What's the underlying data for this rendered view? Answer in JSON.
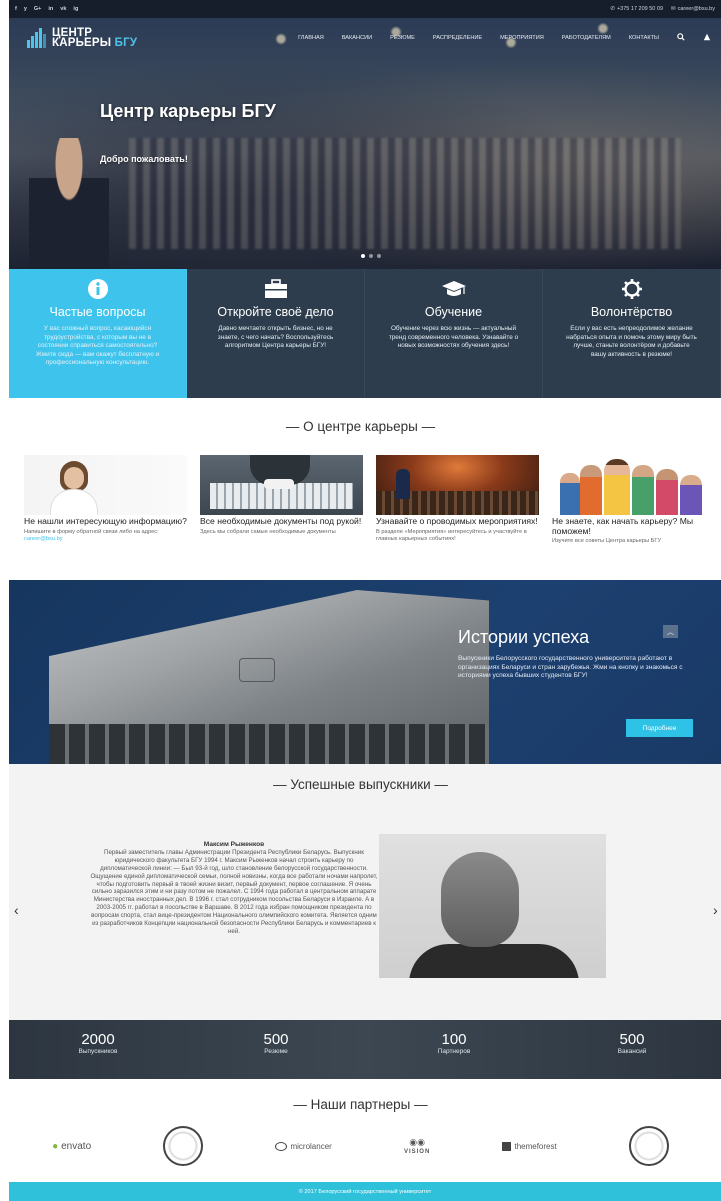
{
  "topbar": {
    "social": [
      "f",
      "y",
      "G+",
      "in",
      "vk",
      "ig"
    ],
    "phone": "+375 17 209 50 09",
    "email": "career@bsu.by"
  },
  "logo": {
    "line1": "ЦЕНТР",
    "line2": "КАРЬЕРЫ",
    "line2_accent": "БГУ"
  },
  "nav": [
    "ГЛАВНАЯ",
    "ВАКАНСИИ",
    "РЕЗЮМЕ",
    "РАСПРЕДЕЛЕНИЕ",
    "МЕРОПРИЯТИЯ",
    "РАБОТОДАТЕЛЯМ",
    "КОНТАКТЫ"
  ],
  "hero": {
    "title": "Центр карьеры БГУ",
    "subtitle": "Добро пожаловать!"
  },
  "tiles": [
    {
      "title": "Частые вопросы",
      "text": "У вас сложный вопрос, касающийся трудоустройства, с которым вы не в состоянии справиться самостоятельно? Жмите сюда — вам окажут бесплатную и профессиональную консультацию."
    },
    {
      "title": "Откройте своё дело",
      "text": "Давно мечтаете открыть бизнес, но не знаете, с чего начать? Воспользуйтесь алгоритмом Центра карьеры БГУ!"
    },
    {
      "title": "Обучение",
      "text": "Обучение через всю жизнь — актуальный тренд современного человека. Узнавайте о новых возможностях обучения здесь!"
    },
    {
      "title": "Волонтёрство",
      "text": "Если у вас есть непреодолимое желание набраться опыта и помочь этому миру быть лучше, станьте волонтёром и добавьте вашу активность в резюме!"
    }
  ],
  "about": {
    "title": "— О центре карьеры —",
    "cards": [
      {
        "title": "Не нашли интересующую информацию?",
        "text": "Напишите в форму обратной связи либо на адрес:",
        "link": "career@bsu.by"
      },
      {
        "title": "Все необходимые документы под рукой!",
        "text": "Здесь мы собрали самые необходимые документы"
      },
      {
        "title": "Узнавайте о проводимых мероприятиях!",
        "text": "В разделе «Мероприятия» интересуйтесь и участвуйте в главных карьерных событиях!"
      },
      {
        "title": "Не знаете, как начать карьеру? Мы поможем!",
        "text": "Изучите все советы Центра карьеры БГУ"
      }
    ]
  },
  "stories": {
    "title": "Истории успеха",
    "text": "Выпускники Белорусского государственного университета работают в организациях Беларуси и стран зарубежья. Жми на кнопку и знакомься с историями успеха бывших студентов БГУ!",
    "button": "Подробнее"
  },
  "graduates": {
    "title": "— Успешные выпускники —",
    "name": "Максим Рыженков",
    "text": "Первый заместитель главы Администрации Президента Республики Беларусь. Выпускник юридического факультета БГУ 1994 г. Максим Рыженков начал строить карьеру по дипломатической линии: — Был 93-й год, шло становление белорусской государственности. Ощущение единой дипломатической семьи, полной новизны, когда все работали ночами напролет, чтобы подготовить первый в твоей жизни визит, первый документ, первое соглашение. Я очень сильно заразился этим и ни разу потом не пожалел. С 1994 года работал в центральном аппарате Министерства иностранных дел. В 1996 г. стал сотрудником посольства Беларуси в Израиле. А в 2003-2005 гг. работал в посольстве в Варшаве. В 2012 года избран помощником президента по вопросам спорта, стал вице-президентом Национального олимпийского комитета. Является одним из разработчиков Концепции национальной безопасности Республики Беларусь и комментариев к ней."
  },
  "stats": [
    {
      "value": "2000",
      "label": "Выпускников"
    },
    {
      "value": "500",
      "label": "Резюме"
    },
    {
      "value": "100",
      "label": "Партнеров"
    },
    {
      "value": "500",
      "label": "Вакансий"
    }
  ],
  "partners": {
    "title": "— Наши партнеры —",
    "items": [
      "envato",
      "microlancer",
      "VISION",
      "themeforest"
    ]
  },
  "footer": "© 2017 Белорусский государственный университет"
}
